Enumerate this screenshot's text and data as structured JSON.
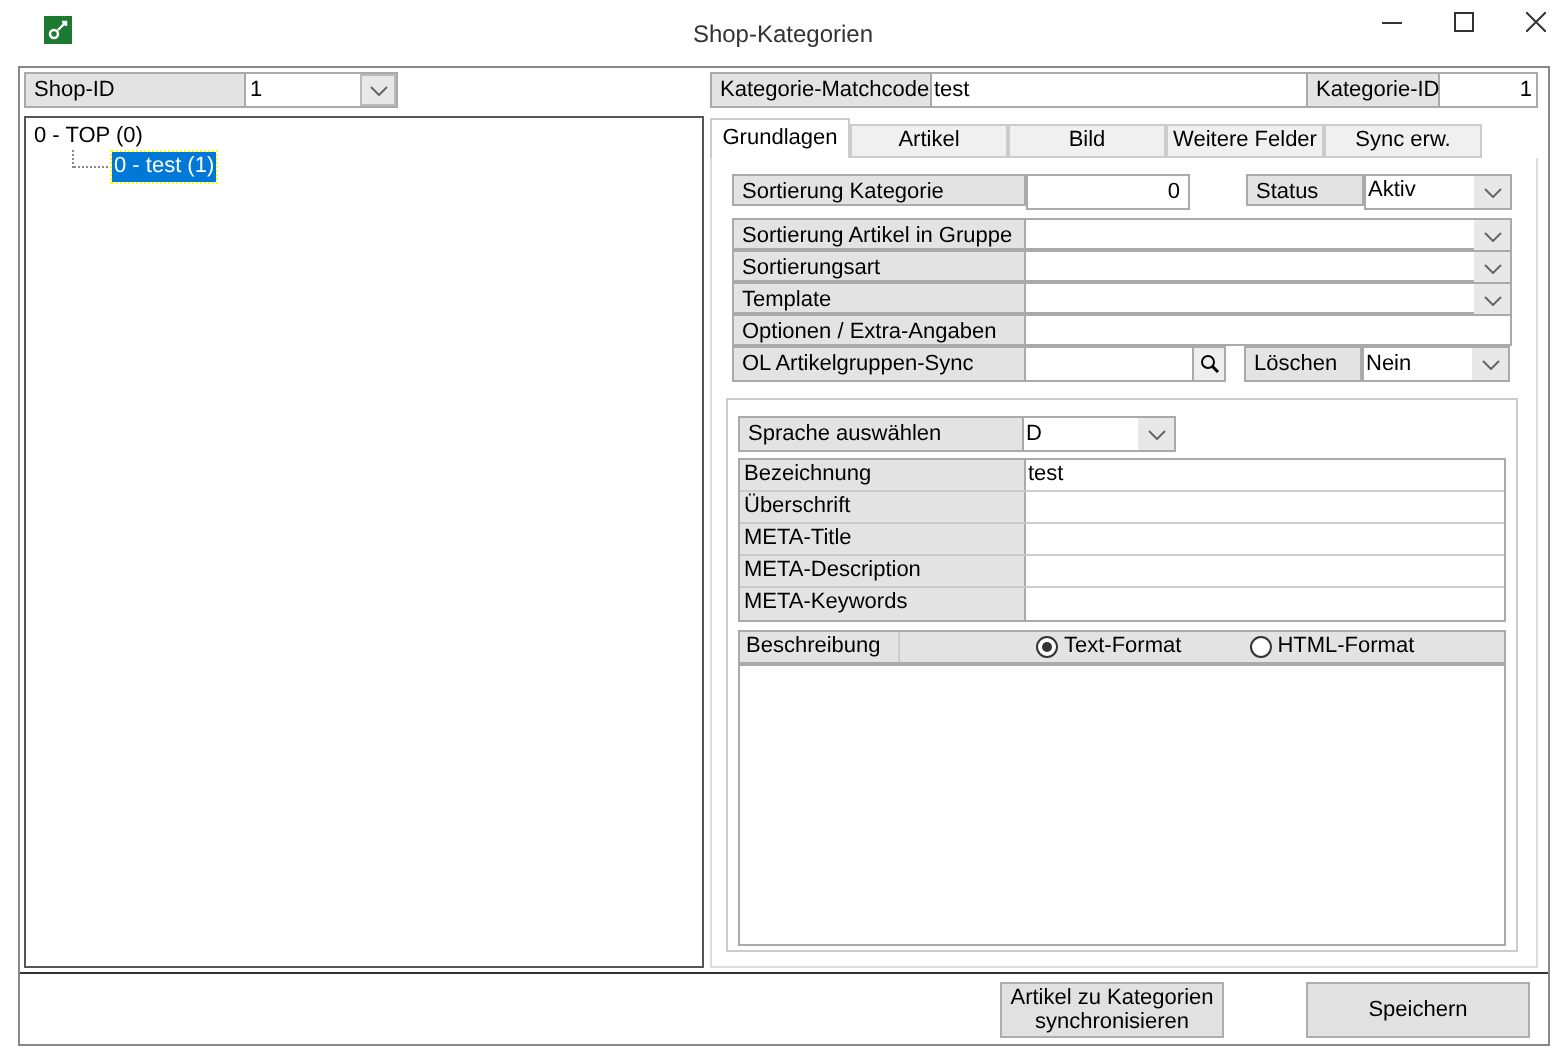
{
  "window": {
    "title": "Shop-Kategorien"
  },
  "shop_id": {
    "label": "Shop-ID",
    "value": "1"
  },
  "tree": [
    {
      "label": "0 - TOP (0)",
      "selected": false,
      "children": [
        {
          "label": "0 - test (1)",
          "selected": true
        }
      ]
    }
  ],
  "matchcode": {
    "label": "Kategorie-Matchcode",
    "value": "test"
  },
  "kategorie_id": {
    "label": "Kategorie-ID",
    "value": "1"
  },
  "tabs": [
    {
      "label": "Grundlagen",
      "selected": true
    },
    {
      "label": "Artikel",
      "selected": false
    },
    {
      "label": "Bild",
      "selected": false
    },
    {
      "label": "Weitere Felder",
      "selected": false
    },
    {
      "label": "Sync erw.",
      "selected": false
    }
  ],
  "sortierung": {
    "label": "Sortierung Kategorie",
    "value": "0"
  },
  "status": {
    "label": "Status",
    "value": "Aktiv"
  },
  "fields": [
    {
      "kind": "dropdown",
      "label": "Sortierung Artikel in Gruppe"
    },
    {
      "kind": "dropdown",
      "label": "Sortierungsart"
    },
    {
      "kind": "dropdown",
      "label": "Template"
    },
    {
      "kind": "text",
      "label": "Optionen / Extra-Angaben"
    }
  ],
  "ol_sync": {
    "label": "OL Artikelgruppen-Sync"
  },
  "loeschen": {
    "label": "Löschen",
    "value": "Nein"
  },
  "sprache": {
    "label": "Sprache auswählen",
    "value": "D"
  },
  "texts": [
    {
      "label": "Bezeichnung",
      "value": "test"
    },
    {
      "label": "Überschrift"
    },
    {
      "label": "META-Title"
    },
    {
      "label": "META-Description"
    },
    {
      "label": "META-Keywords"
    }
  ],
  "beschreibung": {
    "label": "Beschreibung",
    "formats": [
      {
        "label": "Text-Format",
        "selected": true
      },
      {
        "label": "HTML-Format",
        "selected": false
      }
    ]
  },
  "buttons": [
    "Artikel zu Kategorien synchronisieren",
    "Speichern"
  ]
}
